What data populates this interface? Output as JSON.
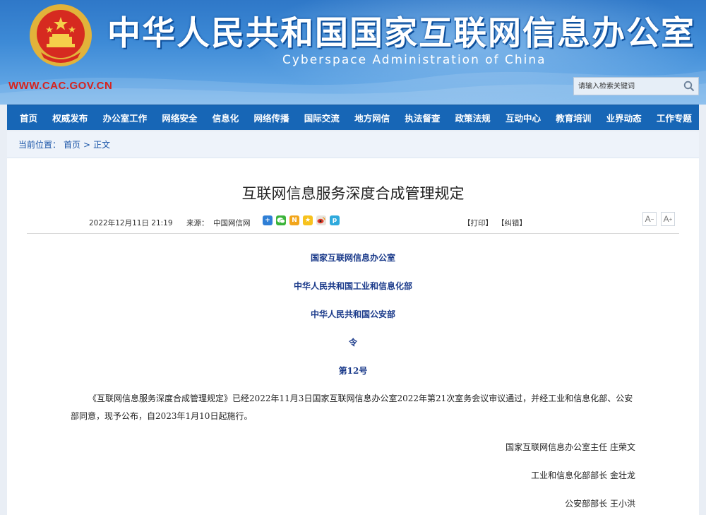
{
  "header": {
    "site_title": "中华人民共和国国家互联网信息办公室",
    "site_subtitle": "Cyberspace Administration of China",
    "domain": "WWW.CAC.GOV.CN",
    "search_placeholder": "请输入检索关键词"
  },
  "nav": {
    "items": [
      "首页",
      "权威发布",
      "办公室工作",
      "网络安全",
      "信息化",
      "网络传播",
      "国际交流",
      "地方网信",
      "执法督查",
      "政策法规",
      "互动中心",
      "教育培训",
      "业界动态",
      "工作专题"
    ]
  },
  "breadcrumb": {
    "label": "当前位置：",
    "home": "首页",
    "separator": ">",
    "current": "正文"
  },
  "article": {
    "title": "互联网信息服务深度合成管理规定",
    "date": "2022年12月11日 21:19",
    "source_label": "来源：",
    "source": "中国网信网",
    "print_label": "【打印】",
    "error_label": "【纠错】",
    "font_smaller": "A",
    "font_larger": "A",
    "issuers": [
      "国家互联网信息办公室",
      "中华人民共和国工业和信息化部",
      "中华人民共和国公安部"
    ],
    "order_label": "令",
    "order_number": "第12号",
    "body": "《互联网信息服务深度合成管理规定》已经2022年11月3日国家互联网信息办公室2022年第21次室务会议审议通过，并经工业和信息化部、公安部同意，现予公布，自2023年1月10日起施行。",
    "signatures": [
      "国家互联网信息办公室主任 庄荣文",
      "工业和信息化部部长 金壮龙",
      "公安部部长 王小洪"
    ]
  },
  "share_icons": [
    "plus-share-icon",
    "wechat-icon",
    "weibo-n-icon",
    "qzone-icon",
    "sina-weibo-icon",
    "other-share-icon"
  ],
  "colors": {
    "nav_bg": "#1766b6",
    "domain_red": "#d6231e",
    "issuer_blue": "#1a3a8a"
  }
}
